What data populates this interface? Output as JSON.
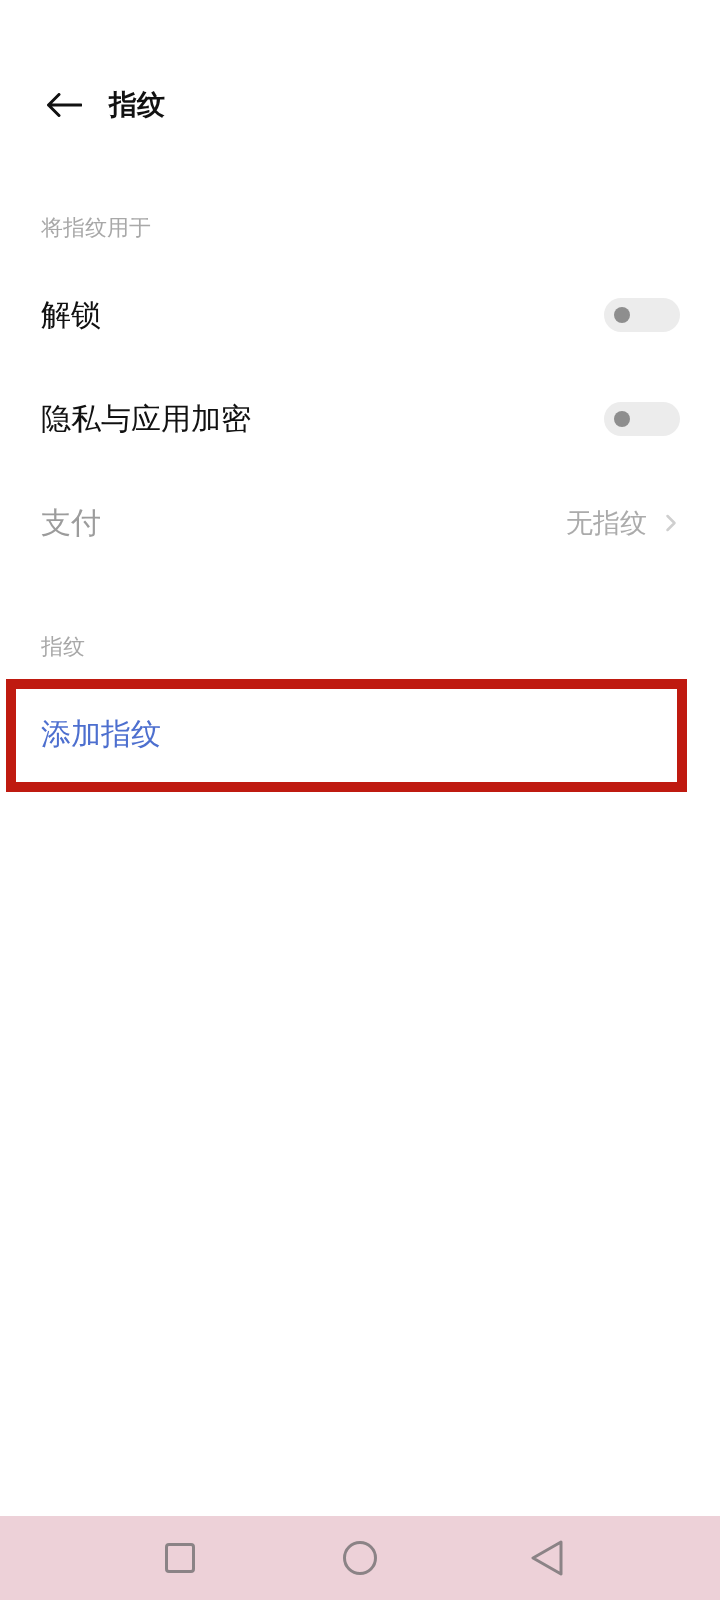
{
  "header": {
    "title": "指纹"
  },
  "sections": [
    {
      "title": "将指纹用于",
      "items": [
        {
          "kind": "toggle",
          "label": "解锁",
          "on": false,
          "disabled": false
        },
        {
          "kind": "toggle",
          "label": "隐私与应用加密",
          "on": false,
          "disabled": false
        },
        {
          "kind": "link",
          "label": "支付",
          "value": "无指纹",
          "disabled": true
        }
      ]
    },
    {
      "title": "指纹",
      "items": [
        {
          "kind": "action",
          "label": "添加指纹",
          "disabled": false,
          "highlighted": true
        }
      ]
    }
  ],
  "nav_bar": {
    "buttons": [
      {
        "kind": "recents"
      },
      {
        "kind": "home"
      },
      {
        "kind": "back"
      }
    ]
  }
}
